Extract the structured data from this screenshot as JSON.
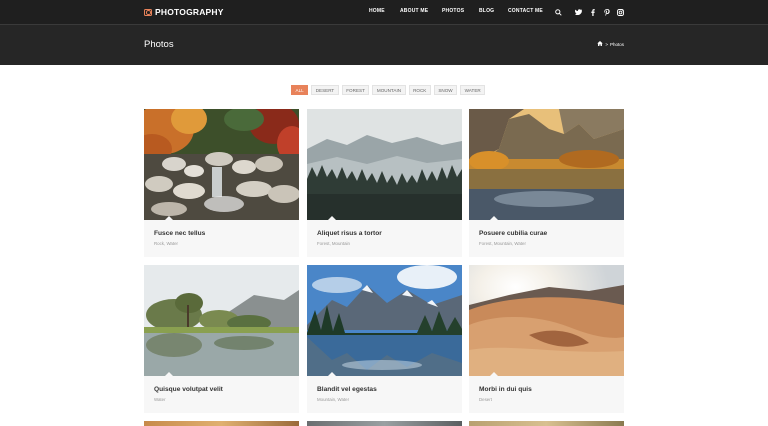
{
  "brand": {
    "name": "PHOTOGRAPHY",
    "icon": "camera-icon",
    "accent": "#e8825a"
  },
  "nav": {
    "items": [
      "HOME",
      "ABOUT ME",
      "PHOTOS",
      "BLOG",
      "CONTACT ME"
    ],
    "icons": [
      "search-icon",
      "twitter-icon",
      "facebook-icon",
      "pinterest-icon",
      "instagram-icon"
    ]
  },
  "header": {
    "title": "Photos",
    "breadcrumb": {
      "home_icon": "home-icon",
      "separator": ">",
      "current": "Photos"
    }
  },
  "filters": [
    "ALL",
    "DESERT",
    "FOREST",
    "MOUNTAIN",
    "ROCK",
    "SNOW",
    "WATER"
  ],
  "active_filter": "ALL",
  "photos": [
    {
      "title": "Fusce nec tellus",
      "tags": "Rock, Water"
    },
    {
      "title": "Aliquet risus a tortor",
      "tags": "Forest, Mountain"
    },
    {
      "title": "Posuere cubilia curae",
      "tags": "Forest, Mountain, Water"
    },
    {
      "title": "Quisque volutpat velit",
      "tags": "Water"
    },
    {
      "title": "Blandit vel egestas",
      "tags": "Mountain, Water"
    },
    {
      "title": "Morbi in dui quis",
      "tags": "Desert"
    }
  ]
}
